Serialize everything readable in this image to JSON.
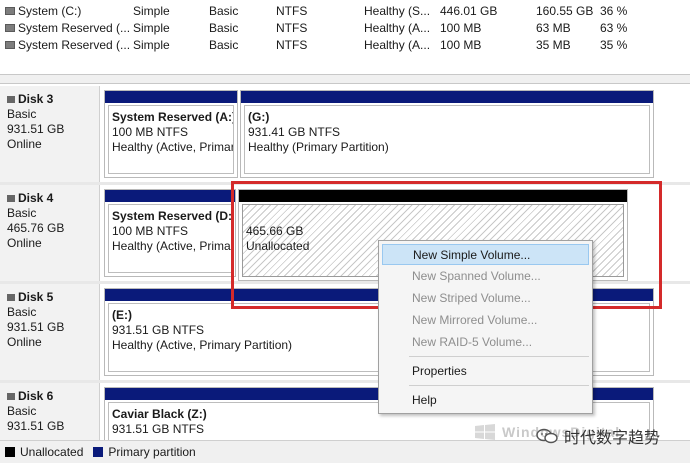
{
  "volumes": [
    {
      "name": "System (C:)",
      "layout": "Simple",
      "type": "Basic",
      "fs": "NTFS",
      "status": "Healthy (S...",
      "capacity": "446.01 GB",
      "free": "160.55 GB",
      "pct": "36 %"
    },
    {
      "name": "System Reserved (...",
      "layout": "Simple",
      "type": "Basic",
      "fs": "NTFS",
      "status": "Healthy (A...",
      "capacity": "100 MB",
      "free": "63 MB",
      "pct": "63 %"
    },
    {
      "name": "System Reserved (...",
      "layout": "Simple",
      "type": "Basic",
      "fs": "NTFS",
      "status": "Healthy (A...",
      "capacity": "100 MB",
      "free": "35 MB",
      "pct": "35 %"
    }
  ],
  "disks": [
    {
      "name": "Disk 3",
      "kind": "Basic",
      "size": "931.51 GB",
      "state": "Online",
      "parts": [
        {
          "title": "System Reserved  (A:)",
          "line2": "100 MB NTFS",
          "line3": "Healthy (Active, Primar"
        },
        {
          "title": "(G:)",
          "line2": "931.41 GB NTFS",
          "line3": "Healthy (Primary Partition)"
        }
      ]
    },
    {
      "name": "Disk 4",
      "kind": "Basic",
      "size": "465.76 GB",
      "state": "Online",
      "parts": [
        {
          "title": "System Reserved  (D:",
          "line2": "100 MB NTFS",
          "line3": "Healthy (Active, Prima"
        },
        {
          "title": "",
          "line2": "465.66 GB",
          "line3": "Unallocated"
        }
      ]
    },
    {
      "name": "Disk 5",
      "kind": "Basic",
      "size": "931.51 GB",
      "state": "Online",
      "parts": [
        {
          "title": "(E:)",
          "line2": "931.51 GB NTFS",
          "line3": "Healthy (Active, Primary Partition)"
        }
      ]
    },
    {
      "name": "Disk 6",
      "kind": "Basic",
      "size": "931.51 GB",
      "state": "",
      "parts": [
        {
          "title": "Caviar Black  (Z:)",
          "line2": "931.51 GB NTFS",
          "line3": ""
        }
      ]
    }
  ],
  "legend": {
    "unallocated": "Unallocated",
    "primary": "Primary partition",
    "unalloc_color": "#000000",
    "primary_color": "#0a1a7a"
  },
  "menu": {
    "new_simple": "New Simple Volume...",
    "new_spanned": "New Spanned Volume...",
    "new_striped": "New Striped Volume...",
    "new_mirrored": "New Mirrored Volume...",
    "new_raid5": "New RAID-5 Volume...",
    "properties": "Properties",
    "help": "Help"
  },
  "watermark": {
    "site": "WindowsDigital",
    "wechat": "时代数字趋势"
  },
  "colors": {
    "highlight": "#d42a2a",
    "hover": "#cce4f7"
  }
}
